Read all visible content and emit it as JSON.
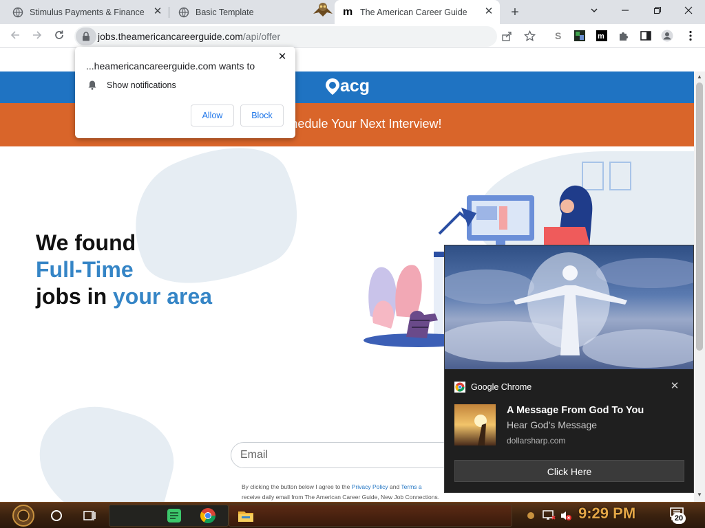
{
  "browser": {
    "tabs": [
      {
        "title": "Stimulus Payments & Finance O",
        "close": "✕"
      },
      {
        "title": "Basic Template",
        "close": ""
      },
      {
        "title": "The American Career Guide",
        "close": "✕"
      }
    ],
    "new_tab": "+",
    "url_host": "jobs.theamericancareerguide.com",
    "url_path": "/api/offer"
  },
  "permission_prompt": {
    "title": "...heamericancareerguide.com wants to",
    "permission": "Show notifications",
    "allow_label": "Allow",
    "block_label": "Block",
    "close": "✕"
  },
  "site": {
    "logo_text": "acg",
    "banner_text": "hedule Your Next Interview!",
    "headline": {
      "line1": "We found",
      "line2": "Full-Time",
      "line3_prefix": "jobs in ",
      "line3_emph": "your area"
    },
    "email_placeholder": "Email",
    "legal_line1_a": "By clicking the button below I agree to the ",
    "legal_link1": "Privacy Policy",
    "legal_line1_b": " and ",
    "legal_link2": "Terms a",
    "legal_line2": "receive daily email from The American Career Guide, New Job Connections."
  },
  "notification": {
    "app": "Google Chrome",
    "title": "A Message From God To You",
    "body": "Hear God's Message",
    "source": "dollarsharp.com",
    "button": "Click Here",
    "close": "✕"
  },
  "taskbar": {
    "clock": "9:29 PM",
    "notification_count": "20"
  },
  "colors": {
    "brand_blue": "#1f73c2",
    "brand_orange": "#d9652a",
    "headline_blue": "#3585c6",
    "clock_orange": "#e4a646"
  }
}
